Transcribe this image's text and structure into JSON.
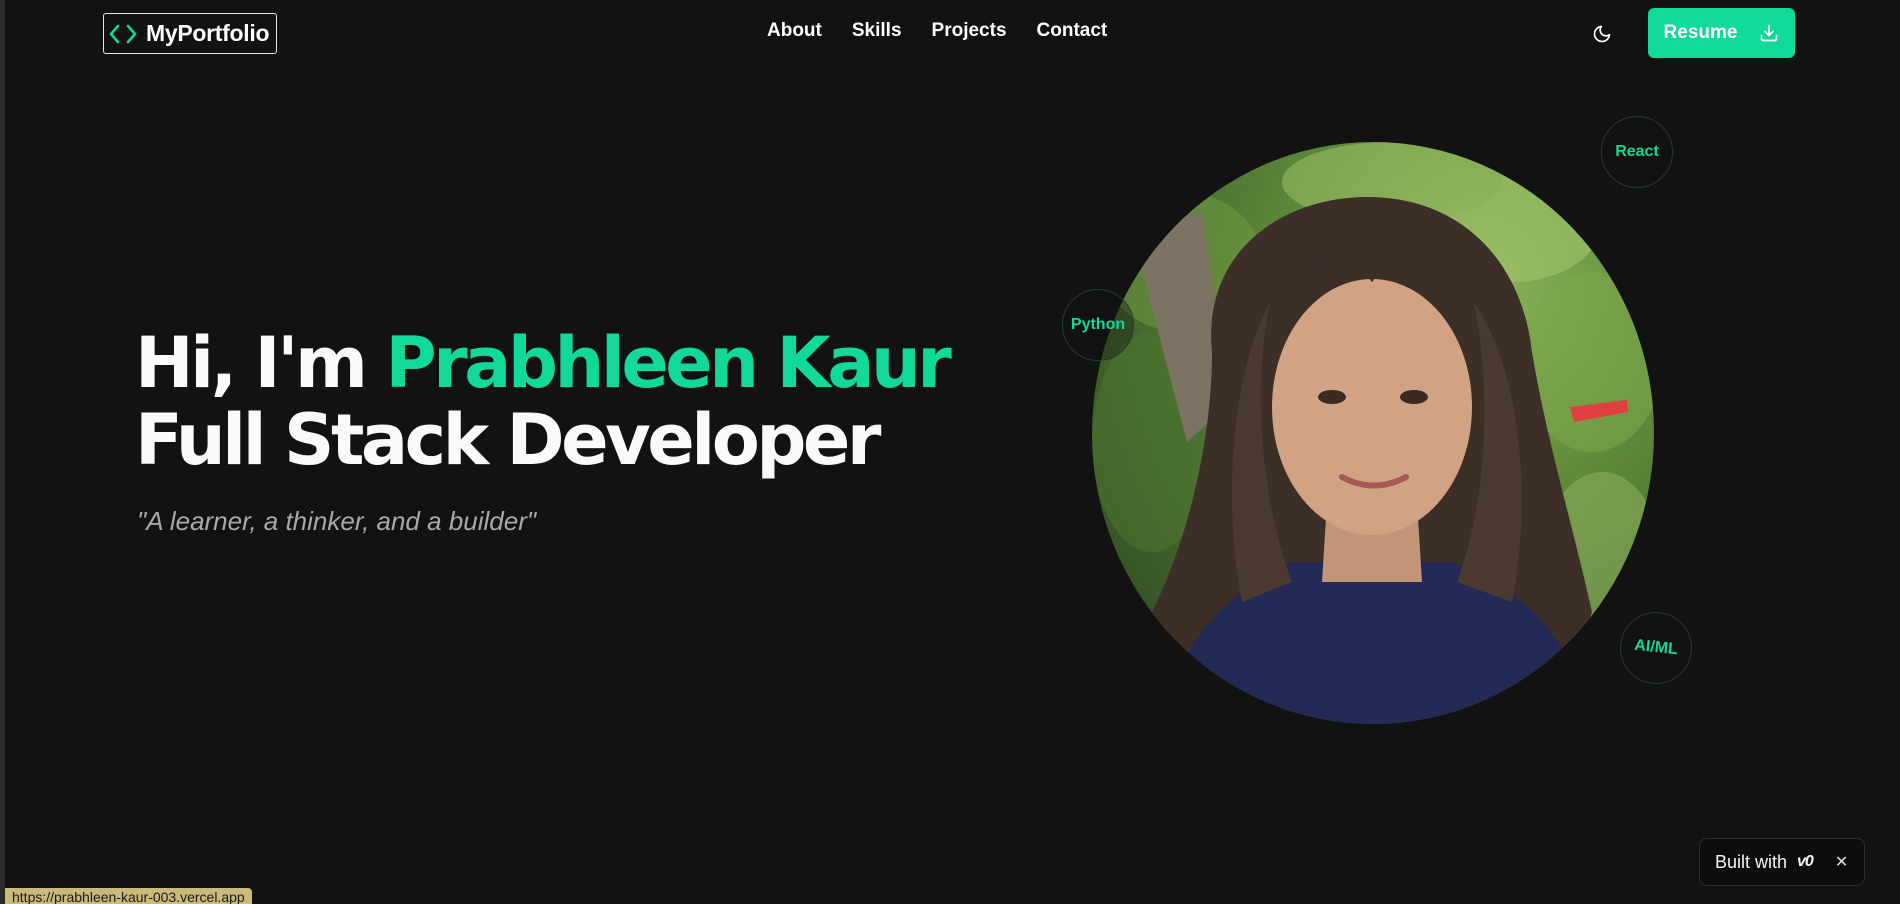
{
  "header": {
    "logo_text": "MyPortfolio",
    "nav": [
      "About",
      "Skills",
      "Projects",
      "Contact"
    ],
    "resume_label": "Resume"
  },
  "hero": {
    "greeting": "Hi, I'm ",
    "name": "Prabhleen Kaur",
    "role": "Full Stack Developer",
    "tagline": "\"A learner, a thinker, and a builder\""
  },
  "skills": [
    "React",
    "Python",
    "AI/ML"
  ],
  "badge": {
    "built_with": "Built with",
    "brand": "v0"
  },
  "status_bar": {
    "url": "https://prabhleen-kaur-003.vercel.app"
  },
  "colors": {
    "accent": "#10d99a",
    "background": "#121212"
  },
  "icons": {
    "logo": "code-brackets-icon",
    "theme": "moon-icon",
    "resume": "download-icon",
    "close": "close-icon"
  }
}
